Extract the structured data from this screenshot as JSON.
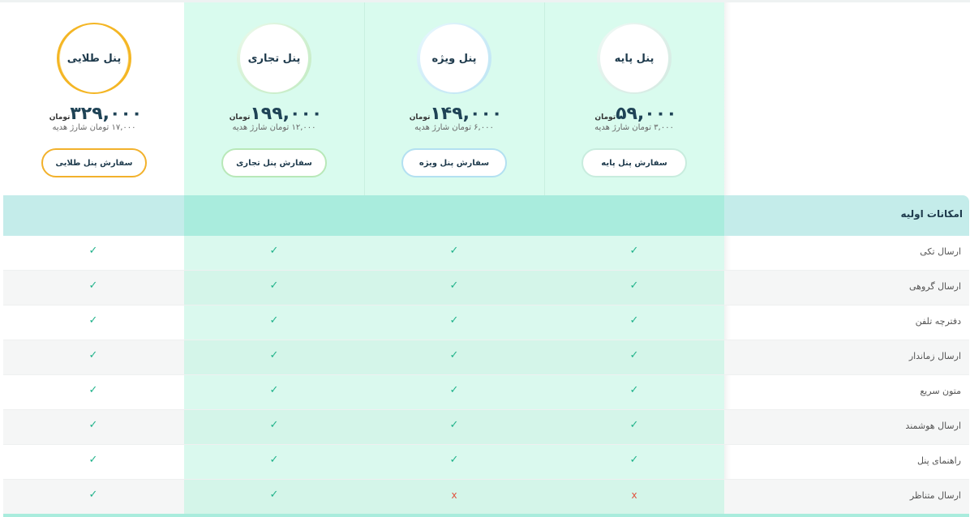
{
  "plans": [
    {
      "key": "gold",
      "title": "پنل طلایی",
      "price": "۳۲۹,۰۰۰",
      "unit": "تومان",
      "gift": "۱۷,۰۰۰ تومان شارژ هدیه",
      "button": "سفارش پنل طلایی",
      "accent": "#f2b12b"
    },
    {
      "key": "biz",
      "title": "پنل تجاری",
      "price": "۱۹۹,۰۰۰",
      "unit": "تومان",
      "gift": "۱۲,۰۰۰ تومان شارژ هدیه",
      "button": "سفارش پنل تجاری",
      "accent": "#b8e8b8"
    },
    {
      "key": "vip",
      "title": "پنل ویژه",
      "price": "۱۴۹,۰۰۰",
      "unit": "تومان",
      "gift": "۶,۰۰۰ تومان شارژ هدیه",
      "button": "سفارش پنل ویژه",
      "accent": "#b3e0f1"
    },
    {
      "key": "base",
      "title": "پنل پایه",
      "price": "۵۹,۰۰۰",
      "unit": "تومان",
      "gift": "۳,۰۰۰ تومان شارژ هدیه",
      "button": "سفارش پنل پایه",
      "accent": "#c8ecde"
    }
  ],
  "features": {
    "heading": "امکانات اولیه",
    "rows": [
      {
        "label": "ارسال تکی",
        "gold": "✓",
        "biz": "✓",
        "vip": "✓",
        "base": "✓"
      },
      {
        "label": "ارسال گروهی",
        "gold": "✓",
        "biz": "✓",
        "vip": "✓",
        "base": "✓"
      },
      {
        "label": "دفترچه تلفن",
        "gold": "✓",
        "biz": "✓",
        "vip": "✓",
        "base": "✓"
      },
      {
        "label": "ارسال زماندار",
        "gold": "✓",
        "biz": "✓",
        "vip": "✓",
        "base": "✓"
      },
      {
        "label": "متون سریع",
        "gold": "✓",
        "biz": "✓",
        "vip": "✓",
        "base": "✓"
      },
      {
        "label": "ارسال هوشمند",
        "gold": "✓",
        "biz": "✓",
        "vip": "✓",
        "base": "✓"
      },
      {
        "label": "راهنمای پنل",
        "gold": "✓",
        "biz": "✓",
        "vip": "✓",
        "base": "✓"
      },
      {
        "label": "ارسال متناظر",
        "gold": "✓",
        "biz": "✓",
        "vip": "x",
        "base": "x"
      }
    ]
  },
  "icons": {
    "check": "check-icon",
    "cross": "cross-icon"
  },
  "colors": {
    "check": "#20b28a",
    "cross": "#e0533f",
    "highlight": "#d9fbee",
    "header": "#c4ecea"
  }
}
